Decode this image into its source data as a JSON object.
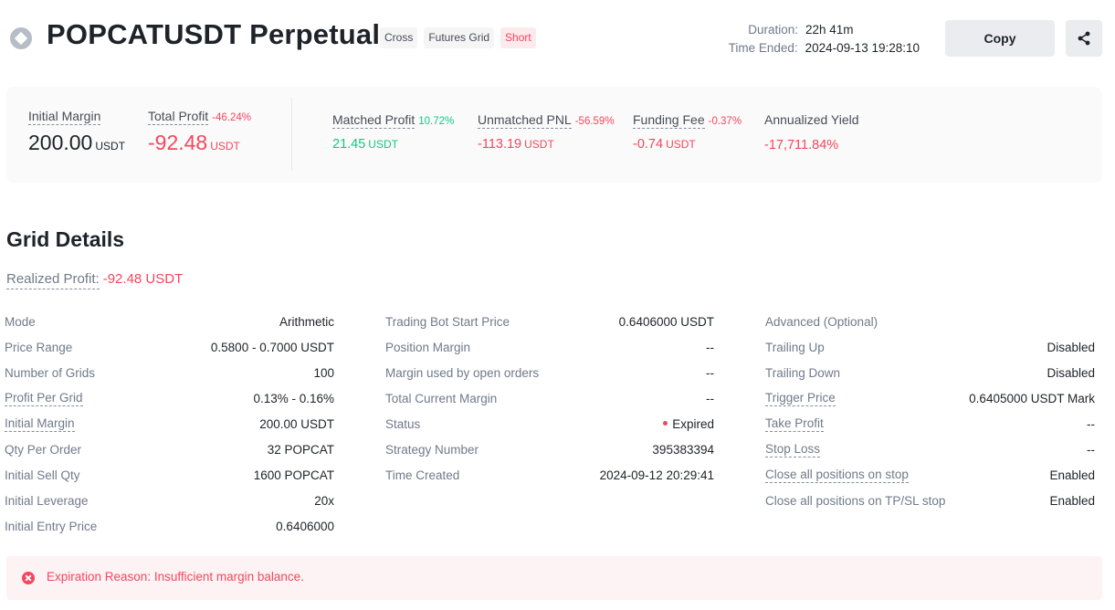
{
  "header": {
    "title": "POPCATUSDT Perpetual",
    "tags": [
      "Cross",
      "Futures Grid",
      "Short"
    ],
    "duration_label": "Duration:",
    "duration_value": "22h 41m",
    "time_ended_label": "Time Ended:",
    "time_ended_value": "2024-09-13 19:28:10",
    "copy_label": "Copy",
    "share_icon": "share-icon",
    "coin_icon": "coin-icon"
  },
  "summary": {
    "initial_margin": {
      "label": "Initial Margin",
      "value": "200.00",
      "unit": "USDT"
    },
    "total_profit": {
      "label": "Total Profit",
      "pct": "-46.24%",
      "value": "-92.48",
      "unit": "USDT"
    },
    "matched_profit": {
      "label": "Matched Profit",
      "pct": "10.72%",
      "value": "21.45",
      "unit": "USDT"
    },
    "unmatched_pnl": {
      "label": "Unmatched PNL",
      "pct": "-56.59%",
      "value": "-113.19",
      "unit": "USDT"
    },
    "funding_fee": {
      "label": "Funding Fee",
      "pct": "-0.37%",
      "value": "-0.74",
      "unit": "USDT"
    },
    "annualized_yield": {
      "label": "Annualized Yield",
      "value": "-17,711.84%"
    }
  },
  "grid_details": {
    "title": "Grid Details",
    "realized_label": "Realized Profit:",
    "realized_value": "-92.48 USDT",
    "col1": [
      {
        "k": "Mode",
        "v": "Arithmetic"
      },
      {
        "k": "Price Range",
        "v": "0.5800 - 0.7000 USDT"
      },
      {
        "k": "Number of Grids",
        "v": "100"
      },
      {
        "k": "Profit Per Grid",
        "v": "0.13% - 0.16%"
      },
      {
        "k": "Initial Margin",
        "v": "200.00 USDT"
      },
      {
        "k": "Qty Per Order",
        "v": "32 POPCAT"
      },
      {
        "k": "Initial Sell Qty",
        "v": "1600 POPCAT"
      },
      {
        "k": "Initial Leverage",
        "v": "20x"
      },
      {
        "k": "Initial Entry Price",
        "v": "0.6406000"
      }
    ],
    "col2": [
      {
        "k": "Trading Bot Start Price",
        "v": "0.6406000 USDT"
      },
      {
        "k": "Position Margin",
        "v": "--"
      },
      {
        "k": "Margin used by open orders",
        "v": "--"
      },
      {
        "k": "Total Current Margin",
        "v": "--"
      },
      {
        "k": "Status",
        "v": "Expired"
      },
      {
        "k": "Strategy Number",
        "v": "395383394"
      },
      {
        "k": "Time Created",
        "v": "2024-09-12 20:29:41"
      }
    ],
    "col3": [
      {
        "k": "Advanced (Optional)",
        "v": ""
      },
      {
        "k": "Trailing Up",
        "v": "Disabled"
      },
      {
        "k": "Trailing Down",
        "v": "Disabled"
      },
      {
        "k": "Trigger Price",
        "v": "0.6405000 USDT Mark"
      },
      {
        "k": "Take Profit",
        "v": "--"
      },
      {
        "k": "Stop Loss",
        "v": "--"
      },
      {
        "k": "Close all positions on stop",
        "v": "Enabled"
      },
      {
        "k": "Close all positions on TP/SL stop",
        "v": "Enabled"
      }
    ]
  },
  "notice": {
    "text": "Expiration Reason: Insufficient margin balance.",
    "icon": "error-icon"
  },
  "colors": {
    "profit": "#0ecb81",
    "loss": "#f6465d",
    "text": "#1e2329",
    "muted": "#707a8a"
  }
}
